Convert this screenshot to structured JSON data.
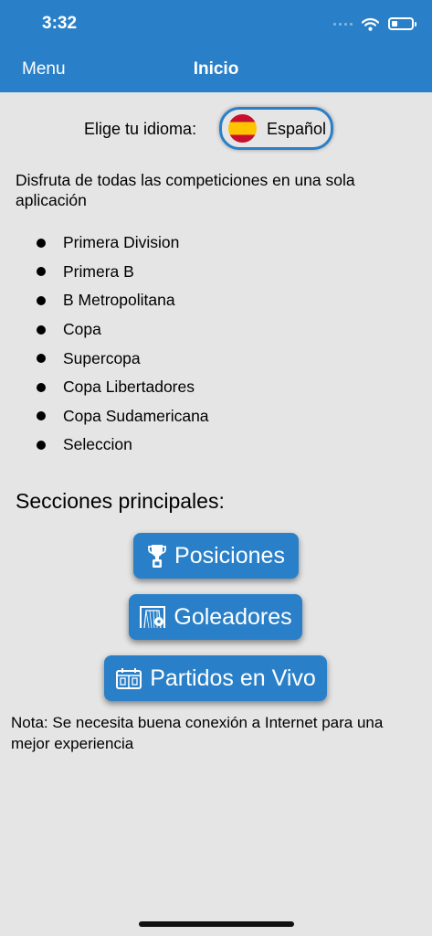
{
  "status_bar": {
    "time": "3:32",
    "icons": [
      "signal-dots-icon",
      "wifi-icon",
      "battery-icon"
    ]
  },
  "nav": {
    "menu_label": "Menu",
    "title": "Inicio"
  },
  "language": {
    "label": "Elige tu idioma:",
    "selected": "Español",
    "flag_icon": "spain-flag-icon"
  },
  "intro_text": "Disfruta de todas las competiciones en una sola aplicación",
  "competitions": [
    "Primera Division",
    "Primera B",
    "B Metropolitana",
    "Copa",
    "Supercopa",
    "Copa Libertadores",
    "Copa Sudamericana",
    "Seleccion"
  ],
  "sections": {
    "title": "Secciones principales:",
    "buttons": [
      {
        "label": "Posiciones",
        "icon": "trophy-icon"
      },
      {
        "label": "Goleadores",
        "icon": "goal-net-icon"
      },
      {
        "label": "Partidos en Vivo",
        "icon": "scoreboard-icon"
      }
    ]
  },
  "note": "Nota: Se necesita buena conexión a Internet para una mejor experiencia",
  "colors": {
    "primary": "#2a80c8",
    "background": "#e5e5e5",
    "flag_red": "#c8102e",
    "flag_yellow": "#ffc400"
  }
}
